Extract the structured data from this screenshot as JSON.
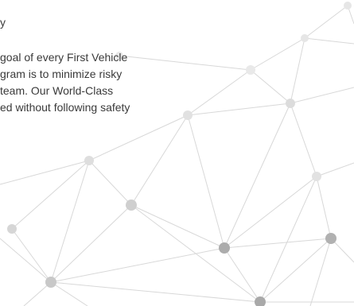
{
  "section": {
    "heading": "y",
    "paragraph_lines": [
      "goal of every First Vehicle",
      "gram is to minimize risky",
      "team. Our World-Class",
      "ed without following safety"
    ]
  },
  "colors": {
    "text": "#3a3a3a",
    "line": "#d6d6d6",
    "node_light": "#e4e4e4",
    "node_mid": "#c8c8c8",
    "node_dark": "#a9a9a9"
  },
  "decoration": {
    "pattern": "network-nodes-and-lines"
  }
}
